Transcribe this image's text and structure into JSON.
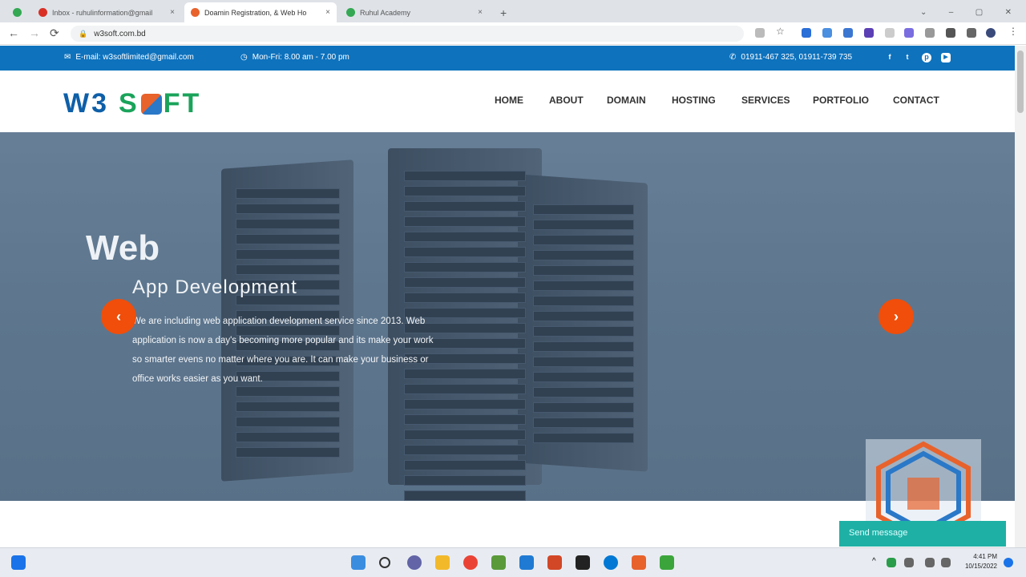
{
  "browser": {
    "tabs": [
      {
        "title": "Inbox - ruhulinformation@gmail",
        "color": "#d93025"
      },
      {
        "title": "Doamin Registration, & Web Ho",
        "color": "#e8622c"
      },
      {
        "title": "Ruhul Academy",
        "color": "#34a853"
      }
    ],
    "url": "w3soft.com.bd",
    "new_tab": "+",
    "back": "←",
    "forward": "→",
    "reload": "⟳"
  },
  "topbar": {
    "email": "E-mail: w3softlimited@gmail.com",
    "hours": "Mon-Fri: 8.00 am - 7.00 pm",
    "phone": "01911-467 325, 01911-739 735",
    "social": [
      "f",
      "t",
      "p",
      "▶"
    ]
  },
  "logo": {
    "w3": "W3",
    "soft": "S",
    "ft": "FT"
  },
  "nav": [
    "HOME",
    "ABOUT",
    "DOMAIN",
    "HOSTING",
    "SERVICES",
    "PORTFOLIO",
    "CONTACT"
  ],
  "hero": {
    "title": "Web",
    "subtitle": "App Development",
    "text": "We are including web application development service since 2013. Web application is now a day's becoming more popular and its make your work so smarter evens no matter where you are. It can make your business or office works easier as you want.",
    "prev": "‹",
    "next": "›"
  },
  "chat": {
    "label": "Send message"
  },
  "clock": {
    "time": "4:41 PM",
    "date": "10/15/2022"
  },
  "colors": {
    "brand_blue": "#0e72bd",
    "accent_orange": "#f04e0a",
    "chat_teal": "#1fb0a5"
  }
}
